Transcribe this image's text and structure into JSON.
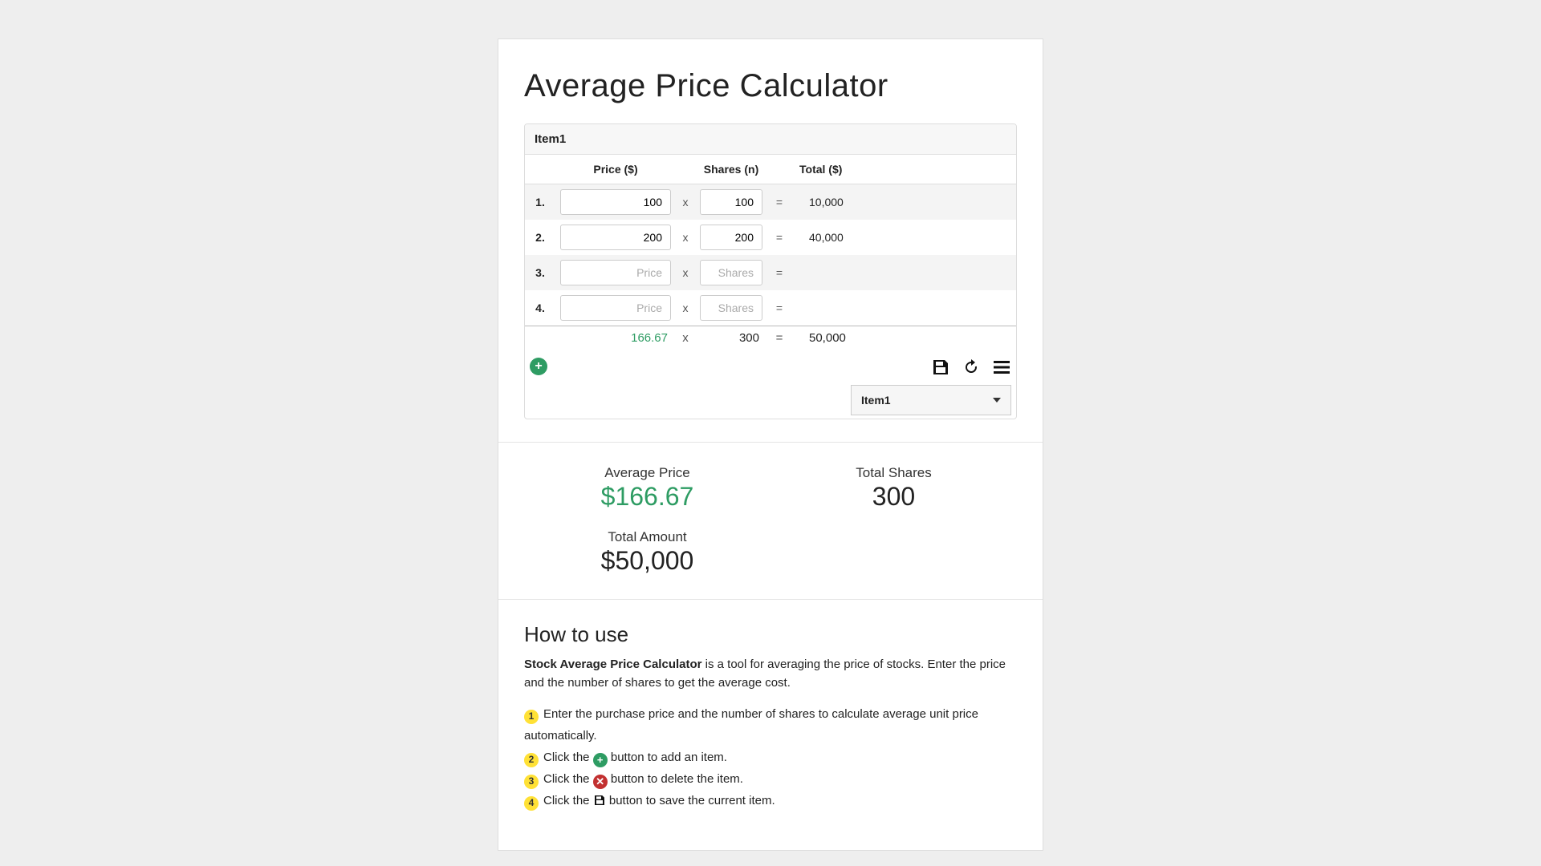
{
  "title": "Average Price Calculator",
  "card": {
    "header": "Item1"
  },
  "columns": {
    "price": "Price ($)",
    "shares": "Shares (n)",
    "total": "Total ($)"
  },
  "symbols": {
    "times": "x",
    "equals": "="
  },
  "placeholders": {
    "price": "Price",
    "shares": "Shares"
  },
  "rows": [
    {
      "num": "1.",
      "price": "100",
      "shares": "100",
      "total": "10,000"
    },
    {
      "num": "2.",
      "price": "200",
      "shares": "200",
      "total": "40,000"
    },
    {
      "num": "3.",
      "price": "",
      "shares": "",
      "total": ""
    },
    {
      "num": "4.",
      "price": "",
      "shares": "",
      "total": ""
    }
  ],
  "summary": {
    "avg_price": "166.67",
    "shares_sum": "300",
    "total_sum": "50,000"
  },
  "select": {
    "value": "Item1"
  },
  "stats": {
    "avg_label": "Average Price",
    "avg_value": "$166.67",
    "shares_label": "Total Shares",
    "shares_value": "300",
    "total_label": "Total Amount",
    "total_value": "$50,000"
  },
  "howto": {
    "heading": "How to use",
    "desc_strong": "Stock Average Price Calculator",
    "desc_rest": " is a tool for averaging the price of stocks. Enter the price and the number of shares to get the average cost.",
    "steps": [
      {
        "n": "1",
        "before": "Enter the purchase price and the number of shares to calculate average unit price automatically.",
        "icon": "",
        "after": ""
      },
      {
        "n": "2",
        "before": "Click the ",
        "icon": "plus",
        "after": " button to add an item."
      },
      {
        "n": "3",
        "before": "Click the ",
        "icon": "delete",
        "after": " button to delete the item."
      },
      {
        "n": "4",
        "before": "Click the ",
        "icon": "save",
        "after": " button to save the current item."
      }
    ]
  }
}
